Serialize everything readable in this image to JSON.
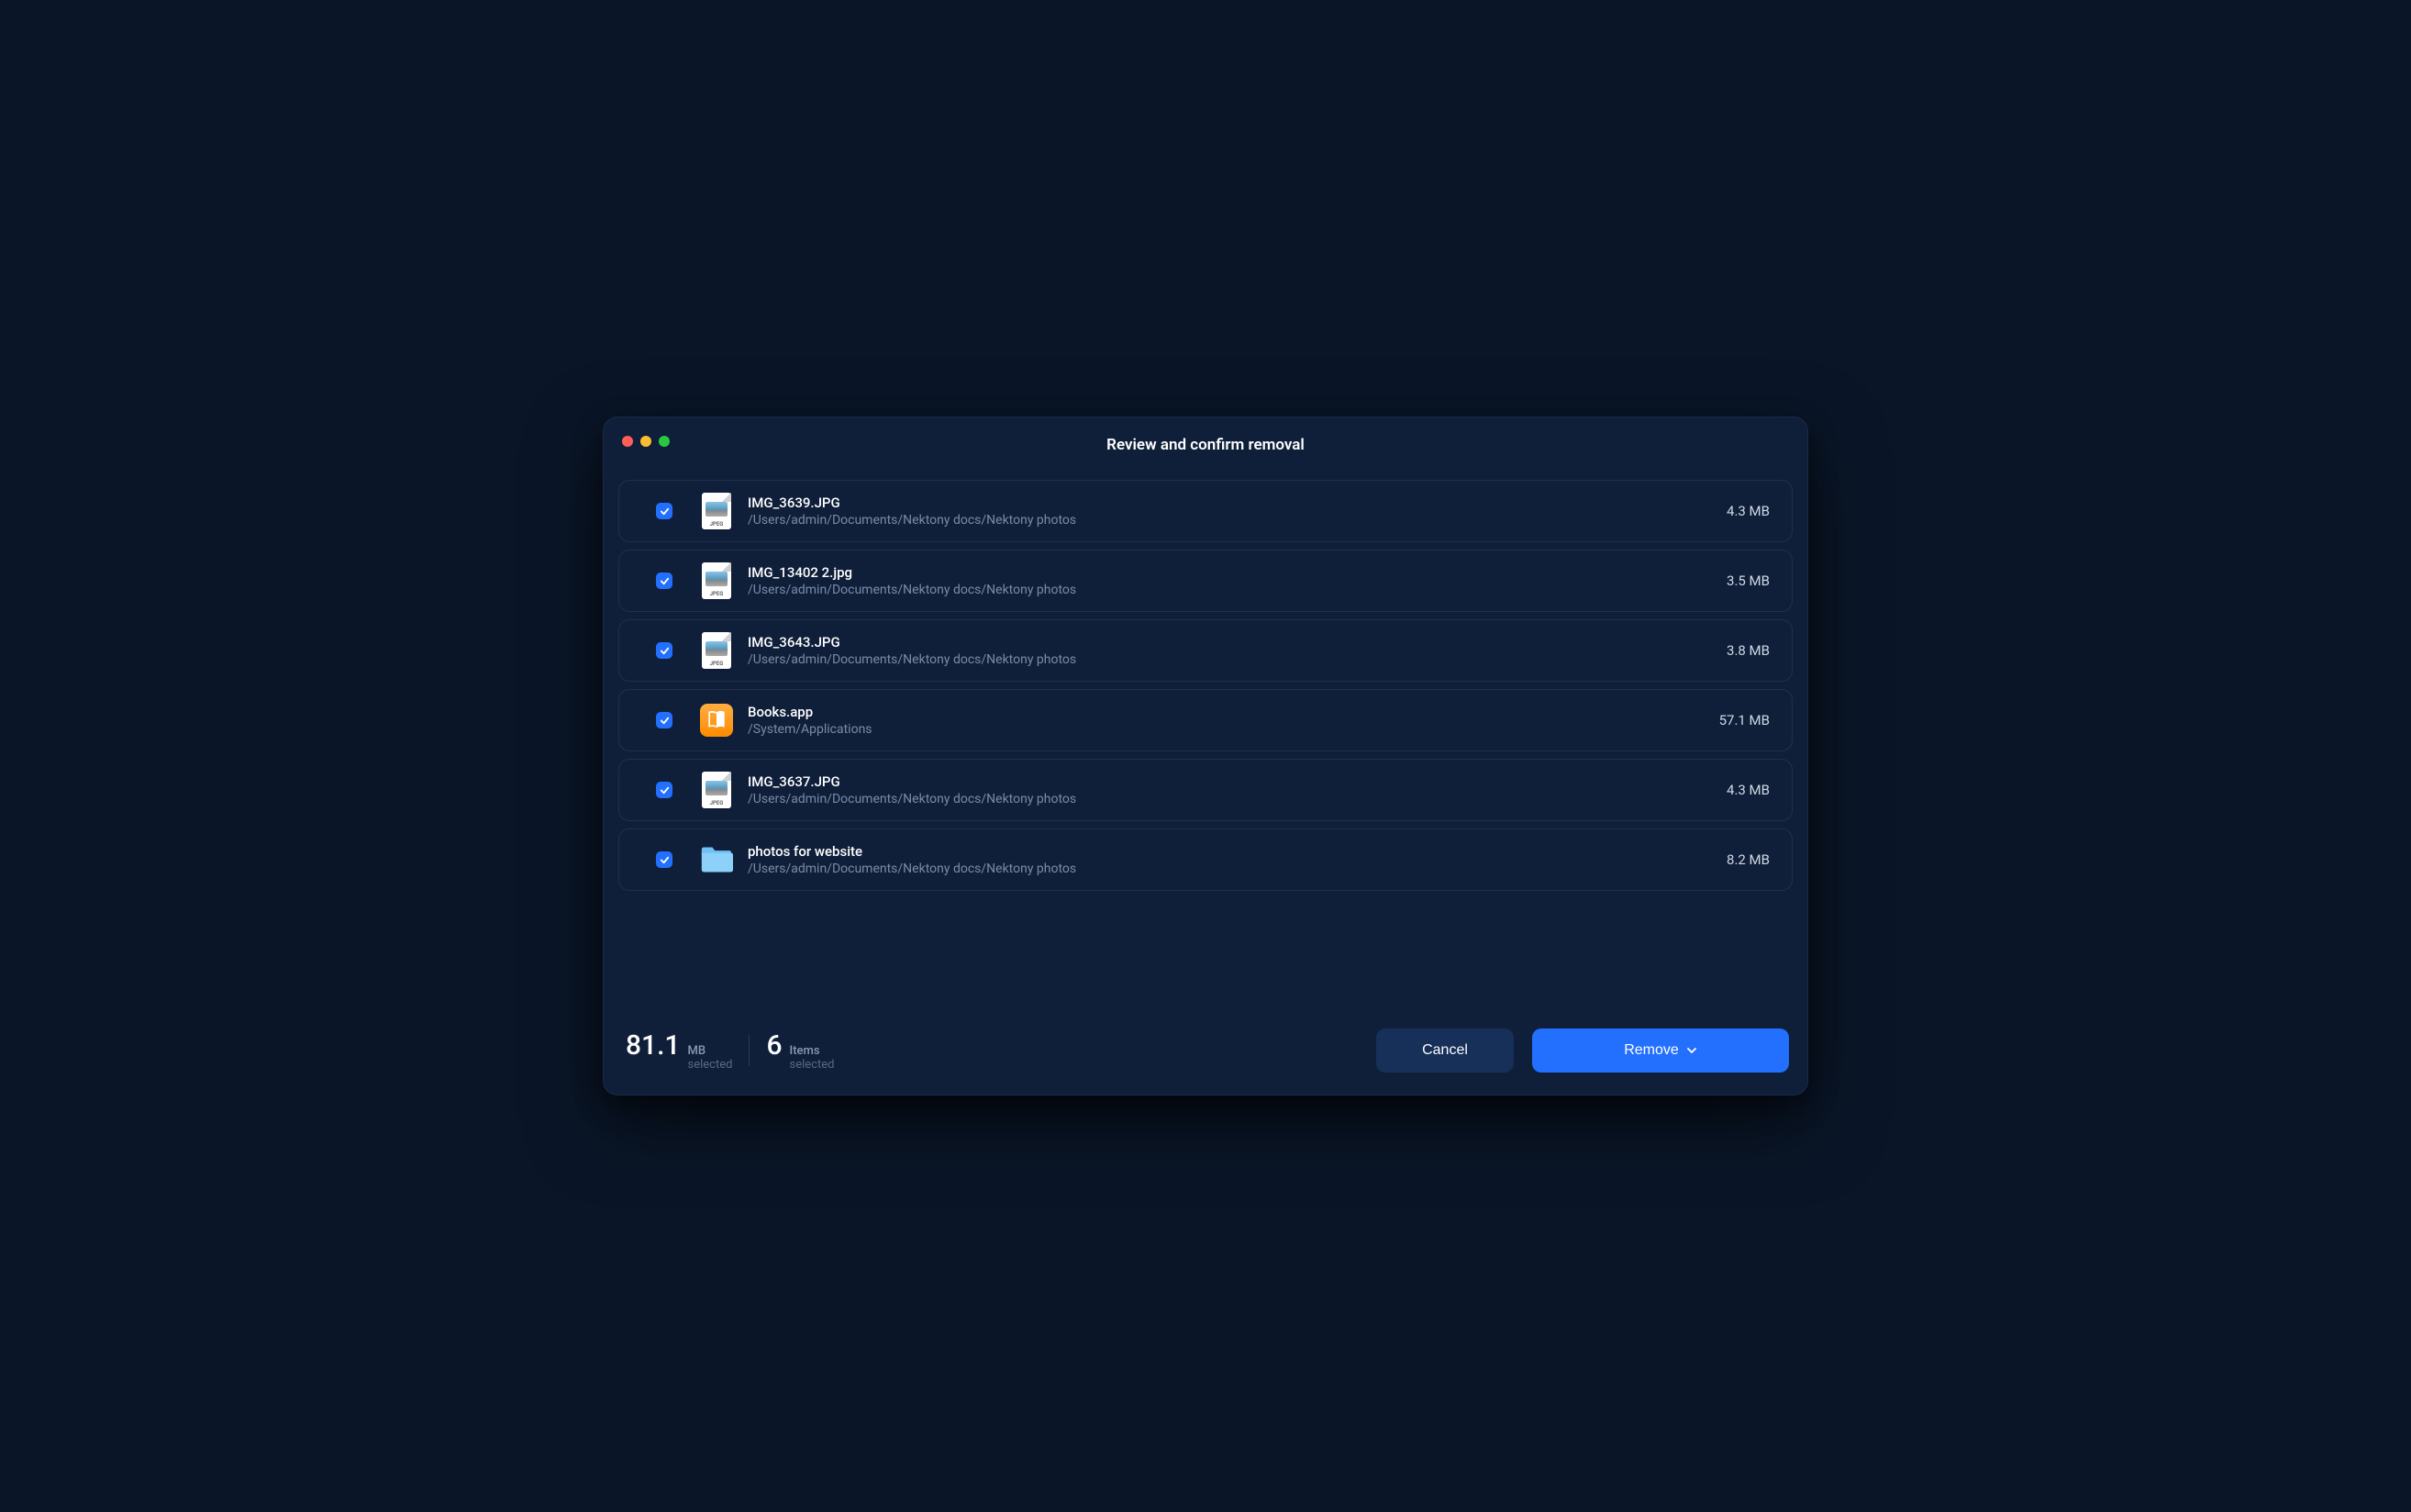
{
  "title": "Review and confirm removal",
  "files": [
    {
      "name": "IMG_3639.JPG",
      "path": "/Users/admin/Documents/Nektony docs/Nektony photos",
      "size": "4.3 MB",
      "icon": "jpeg",
      "checked": true
    },
    {
      "name": "IMG_13402 2.jpg",
      "path": "/Users/admin/Documents/Nektony docs/Nektony photos",
      "size": "3.5 MB",
      "icon": "jpeg",
      "checked": true
    },
    {
      "name": "IMG_3643.JPG",
      "path": "/Users/admin/Documents/Nektony docs/Nektony photos",
      "size": "3.8 MB",
      "icon": "jpeg",
      "checked": true
    },
    {
      "name": "Books.app",
      "path": "/System/Applications",
      "size": "57.1 MB",
      "icon": "books",
      "checked": true
    },
    {
      "name": "IMG_3637.JPG",
      "path": "/Users/admin/Documents/Nektony docs/Nektony photos",
      "size": "4.3 MB",
      "icon": "jpeg",
      "checked": true
    },
    {
      "name": "photos for website",
      "path": "/Users/admin/Documents/Nektony docs/Nektony photos",
      "size": "8.2 MB",
      "icon": "folder",
      "checked": true
    }
  ],
  "footer": {
    "total_size_value": "81.1",
    "total_size_unit": "MB",
    "total_size_sub": "selected",
    "items_value": "6",
    "items_unit": "Items",
    "items_sub": "selected",
    "cancel_label": "Cancel",
    "remove_label": "Remove"
  }
}
